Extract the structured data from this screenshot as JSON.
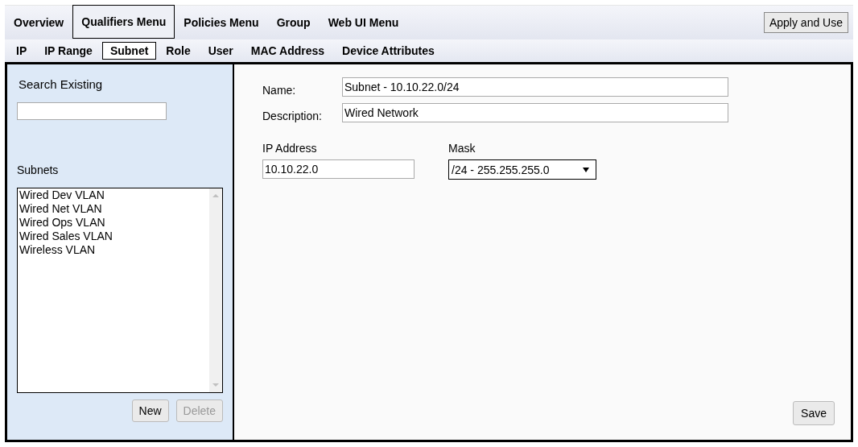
{
  "menu": [
    {
      "label": "Overview",
      "selected": false
    },
    {
      "label": "Qualifiers Menu",
      "selected": true
    },
    {
      "label": "Policies Menu",
      "selected": false
    },
    {
      "label": "Group",
      "selected": false
    },
    {
      "label": "Web UI Menu",
      "selected": false
    }
  ],
  "apply_button": "Apply and Use",
  "tabs": [
    {
      "label": "IP",
      "selected": false
    },
    {
      "label": "IP Range",
      "selected": false
    },
    {
      "label": "Subnet",
      "selected": true
    },
    {
      "label": "Role",
      "selected": false
    },
    {
      "label": "User",
      "selected": false
    },
    {
      "label": "MAC Address",
      "selected": false
    },
    {
      "label": "Device Attributes",
      "selected": false
    }
  ],
  "sidebar": {
    "search_label": "Search Existing",
    "list_label": "Subnets",
    "items": [
      {
        "label": "Wired Dev VLAN",
        "selected": false
      },
      {
        "label": "Wired Net VLAN",
        "selected": false
      },
      {
        "label": "Wired Ops VLAN",
        "selected": false
      },
      {
        "label": "Wired Sales VLAN",
        "selected": false
      },
      {
        "label": "Wireless VLAN",
        "selected": false
      }
    ],
    "buttons": [
      {
        "label": "New",
        "disabled": false
      },
      {
        "label": "Delete",
        "disabled": true
      }
    ]
  },
  "form": {
    "name_label": "Name:",
    "name": "Subnet - 10.10.22.0/24",
    "description_label": "Description:",
    "description": "Wired Network",
    "ip_label": "IP Address",
    "ip": "10.10.22.0",
    "mask_label": "Mask",
    "mask": "/24 - 255.255.255.0"
  },
  "save_button": "Save"
}
